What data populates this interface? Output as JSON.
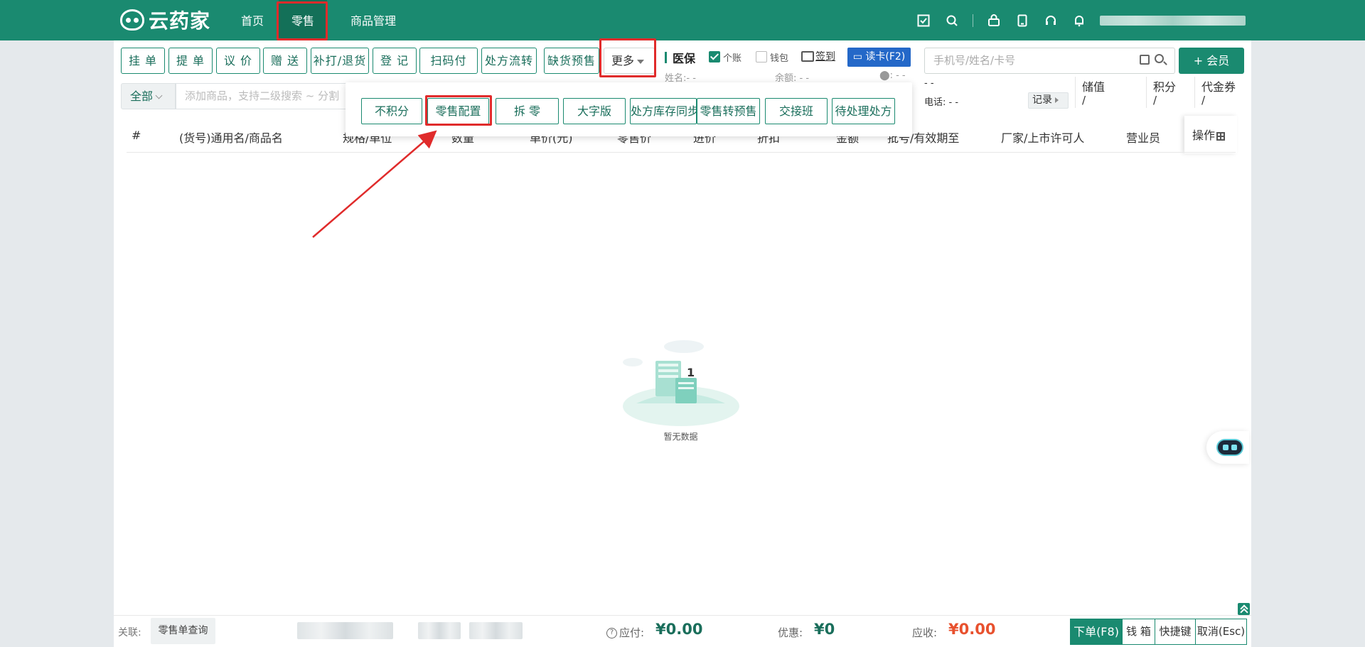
{
  "app": {
    "brand": "云药家"
  },
  "nav": {
    "home": "首页",
    "retail": "零售",
    "goods": "商品管理"
  },
  "toolbar": {
    "buttons": [
      "挂 单",
      "提 单",
      "议 价",
      "赠 送",
      "补打/退货",
      "登 记",
      "扫码付",
      "处方流转",
      "缺货预售"
    ],
    "more": "更多"
  },
  "medical": {
    "title": "医保",
    "personal_account": "个账",
    "wallet": "钱包",
    "sign_in": "签到",
    "read_card": "读卡(F2)",
    "name_label": "姓名:- -",
    "balance_label": "余额: - -",
    "loc_label": ": - -"
  },
  "member": {
    "placeholder": "手机号/姓名/卡号",
    "add_button": "+ 会员",
    "dash": "- -",
    "phone": "电话: - -",
    "record": "记录",
    "stored_value_label": "储值",
    "stored_value": "/",
    "points_label": "积分",
    "points": "/",
    "voucher_label": "代金券",
    "voucher": "/"
  },
  "search": {
    "category": "全部",
    "placeholder": "添加商品，支持二级搜索 ~ 分割"
  },
  "more_menu": [
    "不积分",
    "零售配置",
    "拆 零",
    "大字版",
    "处方库存同步",
    "零售转预售",
    "交接班",
    "待处理处方"
  ],
  "table": {
    "columns": [
      "#",
      "(货号)通用名/商品名",
      "规格/单位",
      "数量",
      "单价(元)",
      "零售价",
      "进价",
      "折扣",
      "金额",
      "批号/有效期至",
      "厂家/上市许可人",
      "营业员"
    ],
    "operations": "操作"
  },
  "empty": {
    "text": "暂无数据"
  },
  "footer": {
    "related_label": "关联:",
    "order_query": "零售单查询",
    "payable_label": "应付:",
    "payable_value": "¥0.00",
    "discount_label": "优惠:",
    "discount_value": "¥0",
    "receivable_label": "应收:",
    "receivable_value": "¥0.00",
    "submit": "下单(F8)",
    "cash_box": "钱 箱",
    "shortcuts": "快捷键",
    "cancel": "取消(Esc)"
  },
  "colors": {
    "brand": "#1a8a70",
    "highlight": "#e02b2b",
    "amount_red": "#e8512e",
    "card_blue": "#2468c8"
  }
}
